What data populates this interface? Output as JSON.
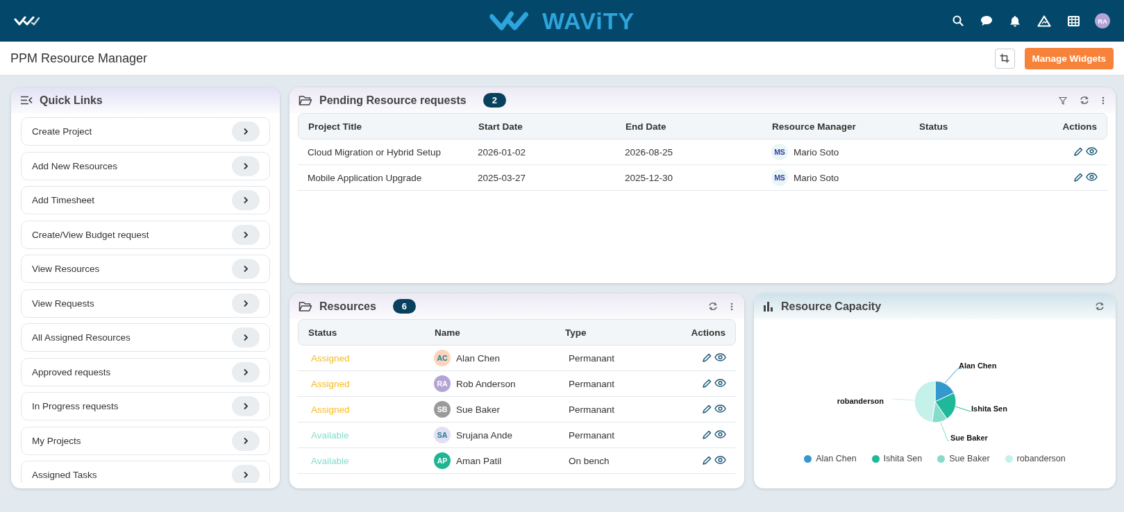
{
  "app_bar": {
    "logo_text": "WAViTY",
    "avatar": "RA"
  },
  "page": {
    "title": "PPM Resource Manager",
    "button": "Manage Widgets"
  },
  "quick_links": {
    "title": "Quick Links",
    "items": [
      {
        "label": "Create Project"
      },
      {
        "label": "Add New Resources"
      },
      {
        "label": "Add Timesheet"
      },
      {
        "label": "Create/View Budget request"
      },
      {
        "label": "View Resources"
      },
      {
        "label": "View Requests"
      },
      {
        "label": "All Assigned Resources"
      },
      {
        "label": "Approved requests"
      },
      {
        "label": "In Progress requests"
      },
      {
        "label": "My Projects"
      },
      {
        "label": "Assigned Tasks"
      }
    ]
  },
  "pending": {
    "title": "Pending Resource requests",
    "count": "2",
    "columns": [
      "Project Title",
      "Start Date",
      "End Date",
      "Resource Manager",
      "Status",
      "Actions"
    ],
    "rows": [
      {
        "project_title": "Cloud Migration or Hybrid Setup",
        "start_date": "2026-01-02",
        "end_date": "2026-08-25",
        "manager": {
          "initials": "MS",
          "name": "Mario Soto",
          "color": "#e8f6f6"
        }
      },
      {
        "project_title": "Mobile Application Upgrade",
        "start_date": "2025-03-27",
        "end_date": "2025-12-30",
        "manager": {
          "initials": "MS",
          "name": "Mario Soto",
          "color": "#e8f6f6"
        }
      }
    ]
  },
  "resources": {
    "title": "Resources",
    "count": "6",
    "columns": [
      "Status",
      "Name",
      "Type",
      "Actions"
    ],
    "rows": [
      {
        "status": {
          "text": "Assigned",
          "color": "#f7bb1e"
        },
        "avatar": {
          "initials": "AC",
          "color": "#fdd3bd"
        },
        "name": "Alan Chen",
        "type": "Permanant"
      },
      {
        "status": {
          "text": "Assigned",
          "color": "#f7bb1e"
        },
        "avatar": {
          "initials": "RA",
          "color": "#b4a3d4"
        },
        "name": "Rob Anderson",
        "type": "Permanant"
      },
      {
        "status": {
          "text": "Assigned",
          "color": "#f7bb1e"
        },
        "avatar": {
          "initials": "SB",
          "color": "#9a9a9a"
        },
        "name": "Sue Baker",
        "type": "Permanant"
      },
      {
        "status": {
          "text": "Available",
          "color": "#86dccb"
        },
        "avatar": {
          "initials": "SA",
          "color": "#e4def4"
        },
        "name": "Srujana Ande",
        "type": "Permanant"
      },
      {
        "status": {
          "text": "Available",
          "color": "#86dccb"
        },
        "avatar": {
          "initials": "AP",
          "color": "#1fb592"
        },
        "name": "Aman Patil",
        "type": "On bench"
      }
    ]
  },
  "capacity": {
    "title": "Resource Capacity",
    "slices": [
      {
        "label": "Alan Chen",
        "color": "#3399cc"
      },
      {
        "label": "Ishita Sen",
        "color": "#1fb89a"
      },
      {
        "label": "Sue Baker",
        "color": "#86dccb"
      },
      {
        "label": "robanderson",
        "color": "#c4f1ea"
      }
    ],
    "legend": [
      {
        "label": "Alan Chen",
        "color": "#3399cc"
      },
      {
        "label": "Ishita Sen",
        "color": "#1fb89a"
      },
      {
        "label": "Sue Baker",
        "color": "#86dccb"
      },
      {
        "label": "robanderson",
        "color": "#c4f1ea"
      }
    ]
  }
}
